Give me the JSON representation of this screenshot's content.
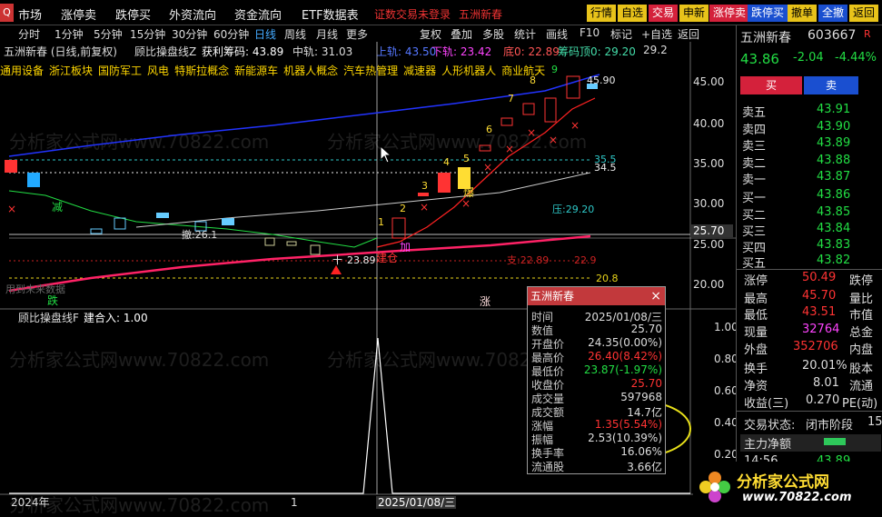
{
  "colors": {
    "up": "#ff3333",
    "down": "#22dd44",
    "bg": "#000000",
    "yellow": "#e8c31a",
    "blue": "#1a4fd0",
    "red": "#d4213b"
  },
  "menubar": {
    "logo": "Q",
    "items": [
      "市场",
      "涨停卖",
      "跌停买",
      "外资流向",
      "资金流向",
      "ETF数据表"
    ],
    "alert": "证数交易未登录",
    "stock_tag": "五洲新春",
    "r_badge": "R"
  },
  "toolbar": {
    "buttons": [
      "行情",
      "自选",
      "交易",
      "申新",
      "涨停卖",
      "跌停买",
      "撤单",
      "全撤",
      "返回"
    ]
  },
  "period_bar": {
    "items": [
      "分时",
      "1分钟",
      "5分钟",
      "15分钟",
      "30分钟",
      "60分钟",
      "日线",
      "周线",
      "月线",
      "更多"
    ],
    "right": [
      "复权",
      "叠加",
      "多股",
      "统计",
      "画线",
      "F10",
      "标记",
      "+自选",
      "返回"
    ]
  },
  "info_line": {
    "name": "五洲新春 (日线,前复权)",
    "indicator": "顾比操盘线Z",
    "profit": "获利筹码: 43.89",
    "mid": "中轨: 31.03",
    "upper": "上轨: 43.50",
    "lower": "下轨: 23.42",
    "bottom": "底0: 22.89",
    "chip": "筹码顶0: 29.20",
    "chip_val": "29.2"
  },
  "concepts": [
    "通用设备",
    "浙江板块",
    "国防军工",
    "风电",
    "特斯拉概念",
    "新能源车",
    "机器人概念",
    "汽车热管理",
    "减速器",
    "人形机器人",
    "商业航天"
  ],
  "chart": {
    "price_axis": [
      "45.00",
      "40.00",
      "35.00",
      "30.00",
      "25.00",
      "20.00"
    ],
    "crosshair_price": "25.70",
    "labels": {
      "p355": "35.5",
      "p345": "34.5",
      "press": "压:29.20",
      "support": "支:22.89",
      "p229": "22.9",
      "p208": "20.8",
      "low": "23.89",
      "high": "45.90",
      "cross_pt": "十",
      "up_pt": "涨",
      "down_pt": "跌",
      "jian": "减",
      "bao": "爆",
      "jia": "加",
      "cang": "建仓",
      "zhi": "撤:26.1",
      "bottom_note": "用到未来数据"
    },
    "nums": [
      "1",
      "2",
      "3",
      "4",
      "5",
      "6",
      "7",
      "8",
      "9"
    ]
  },
  "sub_chart": {
    "title": "顾比操盘线F",
    "value": "建合入: 1.00",
    "axis": [
      "1.00",
      "0.80",
      "0.60",
      "0.40",
      "0.20",
      "0.00"
    ]
  },
  "time_axis": {
    "year": "2024年",
    "mid": "1",
    "date": "2025/01/08/三"
  },
  "quote": {
    "name": "五洲新春",
    "code": "603667",
    "price": "43.86",
    "change": "-2.04",
    "pct": "-4.44%",
    "buy_btn": "买",
    "sell_btn": "卖",
    "asks": [
      {
        "label": "卖五",
        "price": "43.91"
      },
      {
        "label": "卖四",
        "price": "43.90"
      },
      {
        "label": "卖三",
        "price": "43.89"
      },
      {
        "label": "卖二",
        "price": "43.88"
      },
      {
        "label": "卖一",
        "price": "43.87"
      }
    ],
    "bids": [
      {
        "label": "买一",
        "price": "43.86"
      },
      {
        "label": "买二",
        "price": "43.85"
      },
      {
        "label": "买三",
        "price": "43.84"
      },
      {
        "label": "买四",
        "price": "43.83"
      },
      {
        "label": "买五",
        "price": "43.82"
      }
    ],
    "stats": [
      {
        "k": "涨停",
        "v": "50.49",
        "k2": "跌停"
      },
      {
        "k": "最高",
        "v": "45.70",
        "k2": "量比"
      },
      {
        "k": "最低",
        "v": "43.51",
        "k2": "市值"
      },
      {
        "k": "现量",
        "v": "32764",
        "k2": "总金"
      },
      {
        "k": "外盘",
        "v": "352706",
        "k2": "内盘"
      },
      {
        "k": "换手",
        "v": "20.01%",
        "k2": "股本"
      },
      {
        "k": "净资",
        "v": "8.01",
        "k2": "流通"
      },
      {
        "k": "收益(三)",
        "v": "0.270",
        "k2": "PE(动)"
      }
    ],
    "trade_state": "交易状态:",
    "state_val": "闭市阶段",
    "state_tail": "15",
    "main_flow": "主力净额",
    "tick_time": "14:56",
    "tick_price": "43.89"
  },
  "popup": {
    "title": "五洲新春",
    "rows": [
      {
        "k": "时间",
        "v": "2025/01/08/三",
        "c": "#ddd"
      },
      {
        "k": "数值",
        "v": "25.70",
        "c": "#ddd"
      },
      {
        "k": "开盘价",
        "v": "24.35(0.00%)",
        "c": "#ddd"
      },
      {
        "k": "最高价",
        "v": "26.40(8.42%)",
        "c": "#ff3333"
      },
      {
        "k": "最低价",
        "v": "23.87(-1.97%)",
        "c": "#22dd44"
      },
      {
        "k": "收盘价",
        "v": "25.70",
        "c": "#ff3333"
      },
      {
        "k": "成交量",
        "v": "597968",
        "c": "#ddd"
      },
      {
        "k": "成交额",
        "v": "14.7亿",
        "c": "#ddd"
      },
      {
        "k": "涨幅",
        "v": "1.35(5.54%)",
        "c": "#ff3333"
      },
      {
        "k": "振幅",
        "v": "2.53(10.39%)",
        "c": "#ddd"
      },
      {
        "k": "换手率",
        "v": "16.06%",
        "c": "#ddd"
      },
      {
        "k": "流通股",
        "v": "3.66亿",
        "c": "#ddd"
      }
    ]
  },
  "watermark": {
    "text": "分析家公式网www.70822.com",
    "brand": "分析家公式网",
    "url": "www.70822.com"
  }
}
